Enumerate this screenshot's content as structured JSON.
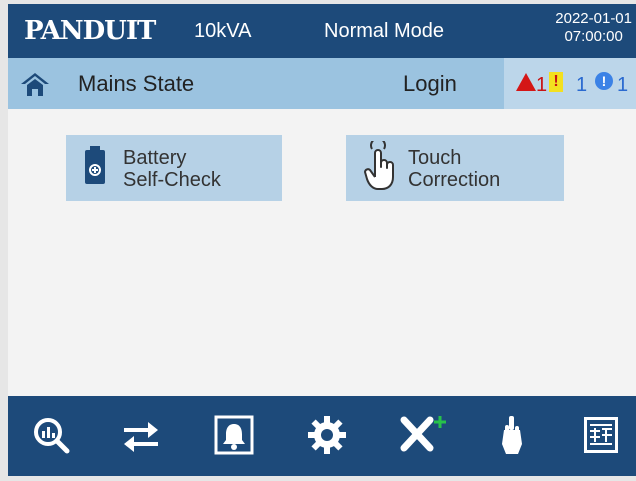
{
  "header": {
    "brand": "PANDUIT",
    "rating": "10kVA",
    "mode": "Normal Mode",
    "date": "2022-01-01",
    "time": "07:00:00"
  },
  "status": {
    "state": "Mains State",
    "login": "Login",
    "alarm_count": "1",
    "warning_count": "1",
    "info_count": "1"
  },
  "tiles": [
    {
      "line1": "Battery",
      "line2": "Self-Check",
      "icon": "battery-icon"
    },
    {
      "line1": "Touch",
      "line2": "Correction",
      "icon": "touch-hand-icon"
    }
  ],
  "nav": [
    "search-icon",
    "transfer-icon",
    "alarm-log-icon",
    "settings-gear-icon",
    "maintenance-tools-icon",
    "touch-icon",
    "report-icon"
  ],
  "colors": {
    "bar": "#1d4a7a",
    "status": "#9bc3e0",
    "tile": "#b6d1e6",
    "alarm": "#d41616",
    "warning": "#f3e01f",
    "info": "#3b82e6"
  }
}
